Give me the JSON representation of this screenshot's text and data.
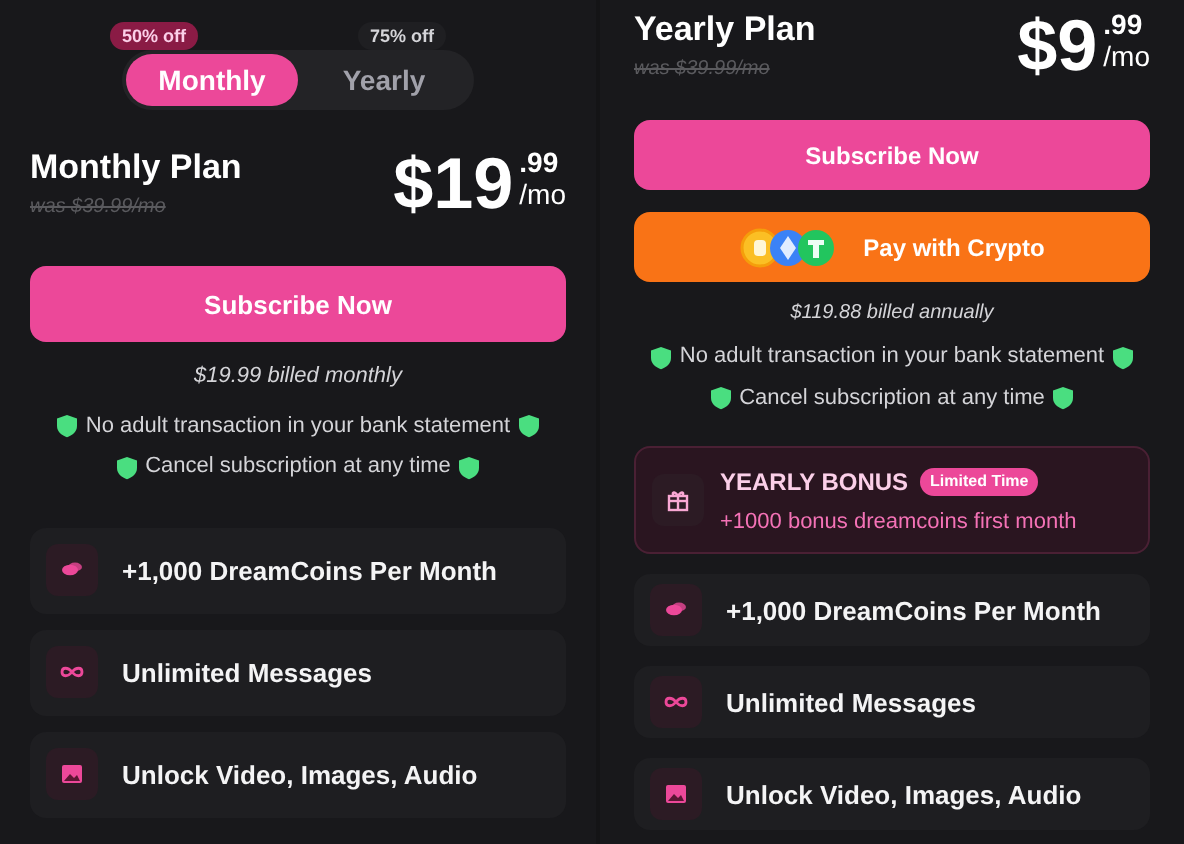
{
  "monthly_panel": {
    "toggle": [
      {
        "label": "Monthly",
        "badge": "50% off",
        "selected": true
      },
      {
        "label": "Yearly",
        "badge": "75% off",
        "selected": false
      }
    ],
    "plan": {
      "name": "Monthly Plan",
      "was": "was $39.99/mo",
      "dollars": "$19",
      "cents": ".99",
      "period": "/mo"
    },
    "subscribe_button": "Subscribe Now",
    "billing_note": "$19.99 billed monthly",
    "guarantees": [
      "No adult transaction in your bank statement",
      "Cancel subscription at any time"
    ],
    "features": [
      {
        "kind": "coins",
        "label": "+1,000 DreamCoins Per Month"
      },
      {
        "kind": "infinity",
        "label": "Unlimited Messages"
      },
      {
        "kind": "media",
        "label": "Unlock Video, Images, Audio"
      }
    ]
  },
  "yearly_panel": {
    "plan": {
      "name": "Yearly Plan",
      "was": "was $39.99/mo",
      "dollars": "$9",
      "cents": ".99",
      "period": "/mo"
    },
    "subscribe_button": "Subscribe Now",
    "crypto_button": "Pay with Crypto",
    "billing_note": "$119.88 billed annually",
    "guarantees": [
      "No adult transaction in your bank statement",
      "Cancel subscription at any time"
    ],
    "bonus": {
      "title": "YEARLY BONUS",
      "tag": "Limited Time",
      "text": "+1000 bonus dreamcoins first month"
    },
    "features": [
      {
        "kind": "coins",
        "label": "+1,000 DreamCoins Per Month"
      },
      {
        "kind": "infinity",
        "label": "Unlimited Messages"
      },
      {
        "kind": "media",
        "label": "Unlock Video, Images, Audio"
      }
    ]
  }
}
